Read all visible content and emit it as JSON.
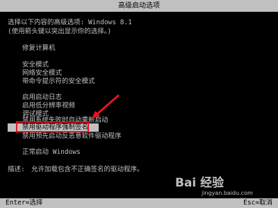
{
  "title": "高级启动选项",
  "header": {
    "line1": "选择以下内容的高级选项: Windows 8.1",
    "line2": "(使用箭头键以突出显示你的选择。)"
  },
  "menu": {
    "repair": "修复计算机",
    "safe_mode": "安全模式",
    "safe_mode_network": "网络安全模式",
    "safe_mode_cmd": "带命令提示符的安全模式",
    "boot_logging": "启用启动日志",
    "low_res_video": "启用低分辨率视频",
    "debug_mode": "调试模式",
    "disable_auto_restart": "禁用系统失败时自动重新启动",
    "disable_driver_signature": "禁用驱动程序强制签名",
    "disable_early_launch": "禁用预先启动反恶意软件驱动程序",
    "start_normally": "正常启动 Windows"
  },
  "description": {
    "label": "描述:",
    "text": "允许加载包含不正确签名的驱动程序。"
  },
  "footer": {
    "left": "Enter=选择",
    "right": "Esc=取消"
  },
  "watermark": {
    "logo": "Bai 经验",
    "url": "jingyan.baidu.com"
  },
  "annotation_color": "#e8141e"
}
